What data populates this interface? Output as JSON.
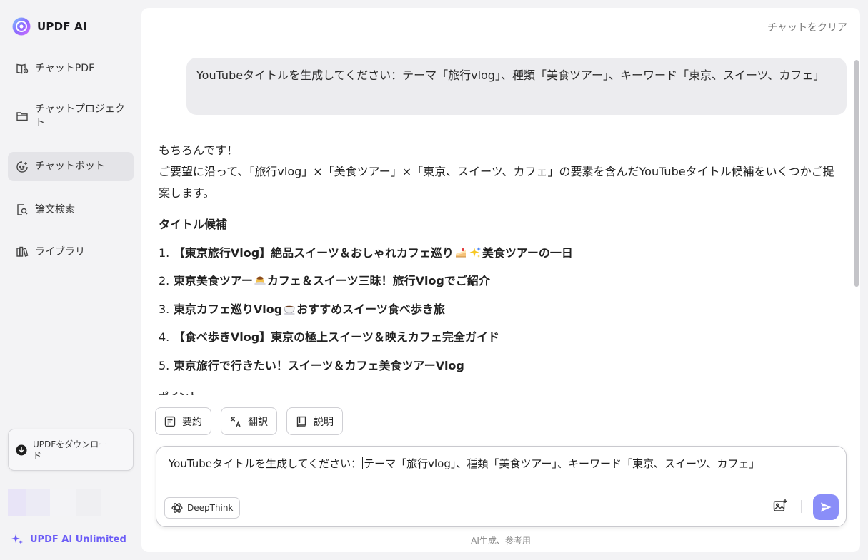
{
  "sidebar": {
    "brand": "UPDF AI",
    "nav": [
      {
        "label": "チャットPDF",
        "icon": "book-chat-icon"
      },
      {
        "label": "チャットプロジェクト",
        "icon": "folder-icon"
      },
      {
        "label": "チャットボット",
        "icon": "bot-icon",
        "active": true
      },
      {
        "label": "論文検索",
        "icon": "document-search-icon"
      },
      {
        "label": "ライブラリ",
        "icon": "library-icon"
      }
    ],
    "download": "UPDFをダウンロード",
    "unlimited": "UPDF AI Unlimited"
  },
  "header": {
    "clear_chat": "チャットをクリア"
  },
  "conversation": {
    "user_message": "YouTubeタイトルを生成してください：テーマ「旅行vlog」、種類「美食ツアー」、キーワード「東京、スイーツ、カフェ」",
    "reply_greeting": "もちろんです！",
    "reply_intro": "ご要望に沿って、「旅行vlog」×「美食ツアー」×「東京、スイーツ、カフェ」の要素を含んだYouTubeタイトル候補をいくつかご提案します。",
    "section_title": "タイトル候補",
    "titles": [
      {
        "num": "1.",
        "before": "【東京旅行Vlog】絶品スイーツ＆おしゃれカフェ巡り",
        "after": "美食ツアーの一日",
        "emojis": [
          "cake-emoji",
          "sparkles-emoji"
        ]
      },
      {
        "num": "2.",
        "before": "東京美食ツアー",
        "after": "カフェ＆スイーツ三昧！旅行Vlogでご紹介",
        "emojis": [
          "pudding-emoji"
        ]
      },
      {
        "num": "3.",
        "before": "東京カフェ巡りVlog",
        "after": "おすすめスイーツ食べ歩き旅",
        "emojis": [
          "coffee-emoji"
        ]
      },
      {
        "num": "4.",
        "before": "【食べ歩きVlog】東京の極上スイーツ＆映えカフェ完全ガイド",
        "after": "",
        "emojis": []
      },
      {
        "num": "5.",
        "before": "東京旅行で行きたい！スイーツ＆カフェ美食ツアーVlog",
        "after": "",
        "emojis": []
      }
    ],
    "peek_text": "ポイント"
  },
  "actions": {
    "summarize": "要約",
    "translate": "翻訳",
    "explain": "説明"
  },
  "input": {
    "before_caret": "YouTubeタイトルを生成してください：",
    "after_caret": "テーマ「旅行vlog」、種類「美食ツアー」、キーワード「東京、スイーツ、カフェ」",
    "deepthink": "DeepThink"
  },
  "footer": {
    "note": "AI生成、参考用"
  },
  "colors": {
    "accent": "#6b5cf6",
    "send": "#8a8ef8"
  }
}
